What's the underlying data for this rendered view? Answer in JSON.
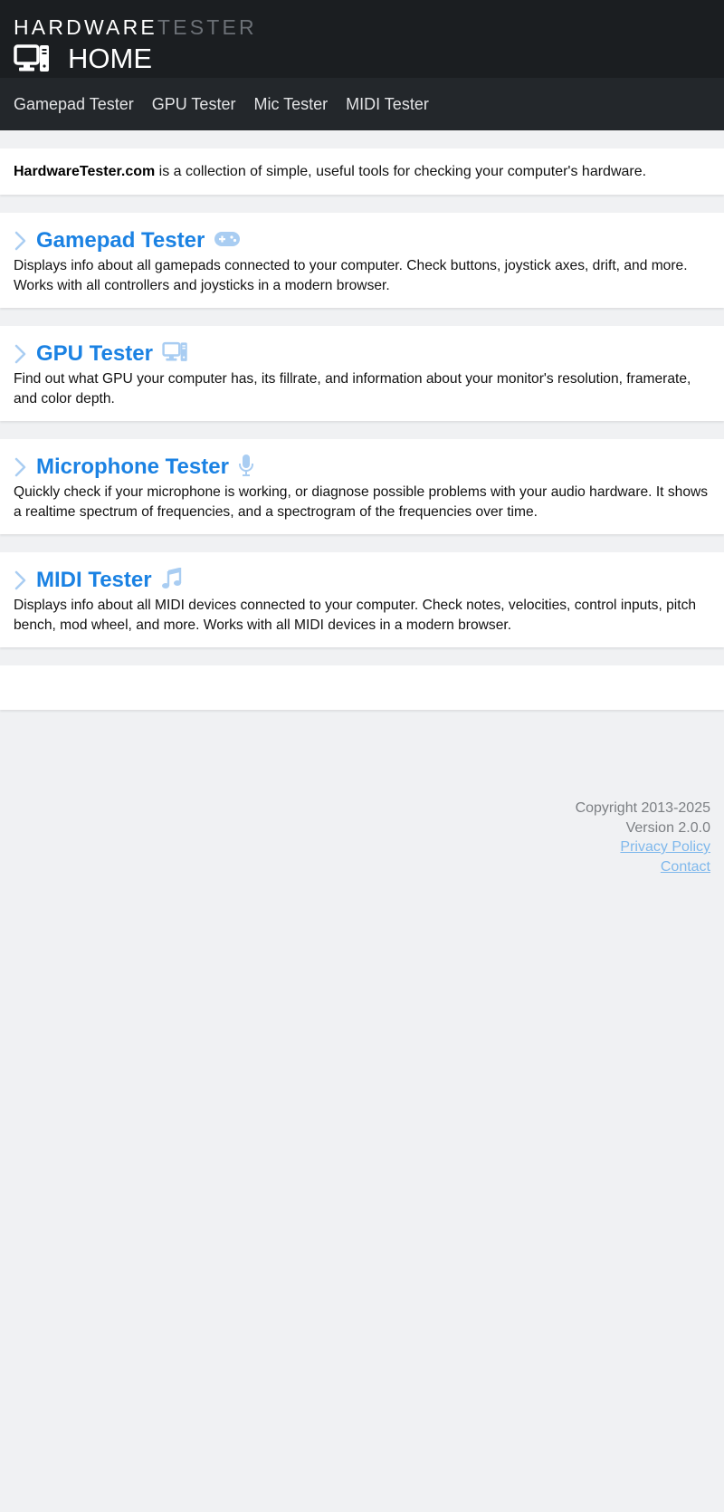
{
  "header": {
    "brand_part1": "HARDWARE",
    "brand_part2": "TESTER",
    "page_title": "HOME",
    "page_icon": "computer-icon"
  },
  "nav": {
    "items": [
      {
        "label": "Gamepad Tester"
      },
      {
        "label": "GPU Tester"
      },
      {
        "label": "Mic Tester"
      },
      {
        "label": "MIDI Tester"
      }
    ]
  },
  "intro": {
    "site_name": "HardwareTester.com",
    "text": " is a collection of simple, useful tools for checking your computer's hardware."
  },
  "tools": [
    {
      "title": "Gamepad Tester",
      "icon": "gamepad-icon",
      "description": "Displays info about all gamepads connected to your computer. Check buttons, joystick axes, drift, and more. Works with all controllers and joysticks in a modern browser."
    },
    {
      "title": "GPU Tester",
      "icon": "computer-icon",
      "description": "Find out what GPU your computer has, its fillrate, and information about your monitor's resolution, framerate, and color depth."
    },
    {
      "title": "Microphone Tester",
      "icon": "microphone-icon",
      "description": "Quickly check if your microphone is working, or diagnose possible problems with your audio hardware. It shows a realtime spectrum of frequencies, and a spectrogram of the frequencies over time."
    },
    {
      "title": "MIDI Tester",
      "icon": "music-note-icon",
      "description": "Displays info about all MIDI devices connected to your computer. Check notes, velocities, control inputs, pitch bench, mod wheel, and more. Works with all MIDI devices in a modern browser."
    }
  ],
  "footer": {
    "copyright": "Copyright 2013-2025",
    "version": "Version 2.0.0",
    "privacy_label": "Privacy Policy",
    "contact_label": "Contact"
  },
  "colors": {
    "header_bg": "#1b1e21",
    "nav_bg": "#23272b",
    "accent": "#1b82e3",
    "icon_light": "#a9cdf2",
    "page_bg": "#f0f1f3"
  }
}
